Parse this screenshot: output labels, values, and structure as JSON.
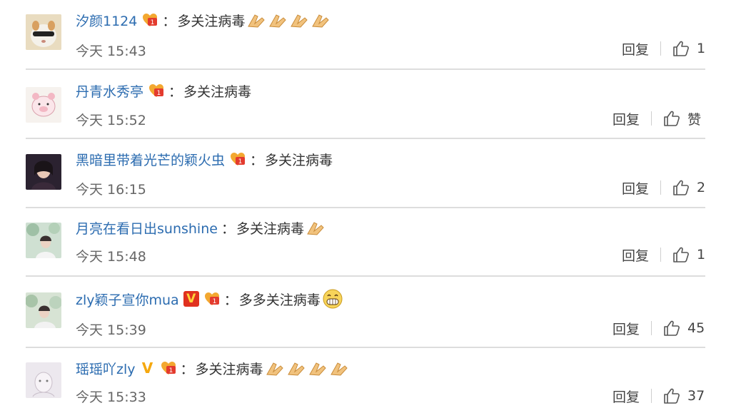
{
  "comments": [
    {
      "user": "汐颜1124",
      "colon": "：",
      "text": "多关注病毒",
      "time": "今天 15:43",
      "reply": "回复",
      "likes": "1",
      "emoji": "clap-hands",
      "emoji_count": 4,
      "vip": false
    },
    {
      "user": "丹青水秀亭",
      "colon": "：",
      "text": "多关注病毒",
      "time": "今天 15:52",
      "reply": "回复",
      "likes": "赞",
      "emoji": "",
      "emoji_count": 0,
      "vip": false
    },
    {
      "user": "黑暗里带着光芒的颖火虫",
      "colon": "：",
      "text": "多关注病毒",
      "time": "今天 16:15",
      "reply": "回复",
      "likes": "2",
      "emoji": "",
      "emoji_count": 0,
      "vip": false
    },
    {
      "user": "月亮在看日出sunshine",
      "colon": "：",
      "text": "多关注病毒",
      "time": "今天 15:48",
      "reply": "回复",
      "likes": "1",
      "emoji": "clap-hands",
      "emoji_count": 1,
      "vip": false
    },
    {
      "user": "zly颖子宣你mua",
      "colon": "：",
      "text": "多多关注病毒",
      "time": "今天 15:39",
      "reply": "回复",
      "likes": "45",
      "emoji": "grin-face",
      "emoji_count": 1,
      "vip": "red-v"
    },
    {
      "user": "瑶瑶吖zly",
      "colon": "：",
      "text": "多关注病毒",
      "time": "今天 15:33",
      "reply": "回复",
      "likes": "37",
      "emoji": "clap-hands",
      "emoji_count": 4,
      "vip": "yellow-v"
    }
  ],
  "colors": {
    "username": "#2c6cb0",
    "text": "#333333",
    "time": "#666666",
    "divider": "#dddddd"
  },
  "icons": {
    "badge": "fan-badge-icon",
    "like": "thumbs-up-icon"
  }
}
